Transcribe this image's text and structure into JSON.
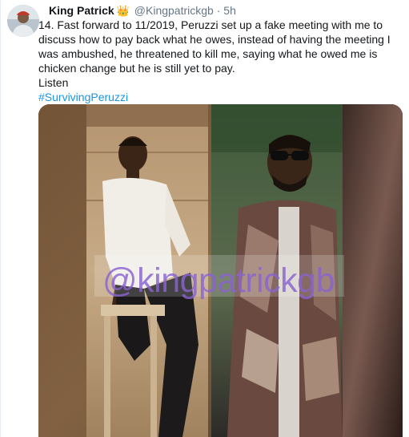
{
  "tweet": {
    "author_name": "King Patrick",
    "author_badge": "👑",
    "author_handle": "@Kingpatrickgb",
    "separator": "·",
    "time": "5h",
    "text": "14. Fast forward to 11/2019, Peruzzi set up a fake meeting with me to discuss how to pay back what he owes, instead of having the meeting I was ambushed, he threatened to kill me, saying what he owed me is chicken change but he is still yet to pay.",
    "text_line2": "Listen",
    "hashtag": "#SurvivingPeruzzi"
  },
  "media": {
    "watermark": "@kingpatrickgb"
  },
  "colors": {
    "name": "#14171a",
    "secondary": "#657786",
    "link": "#1b95e0",
    "watermark": "#8a63d2"
  }
}
